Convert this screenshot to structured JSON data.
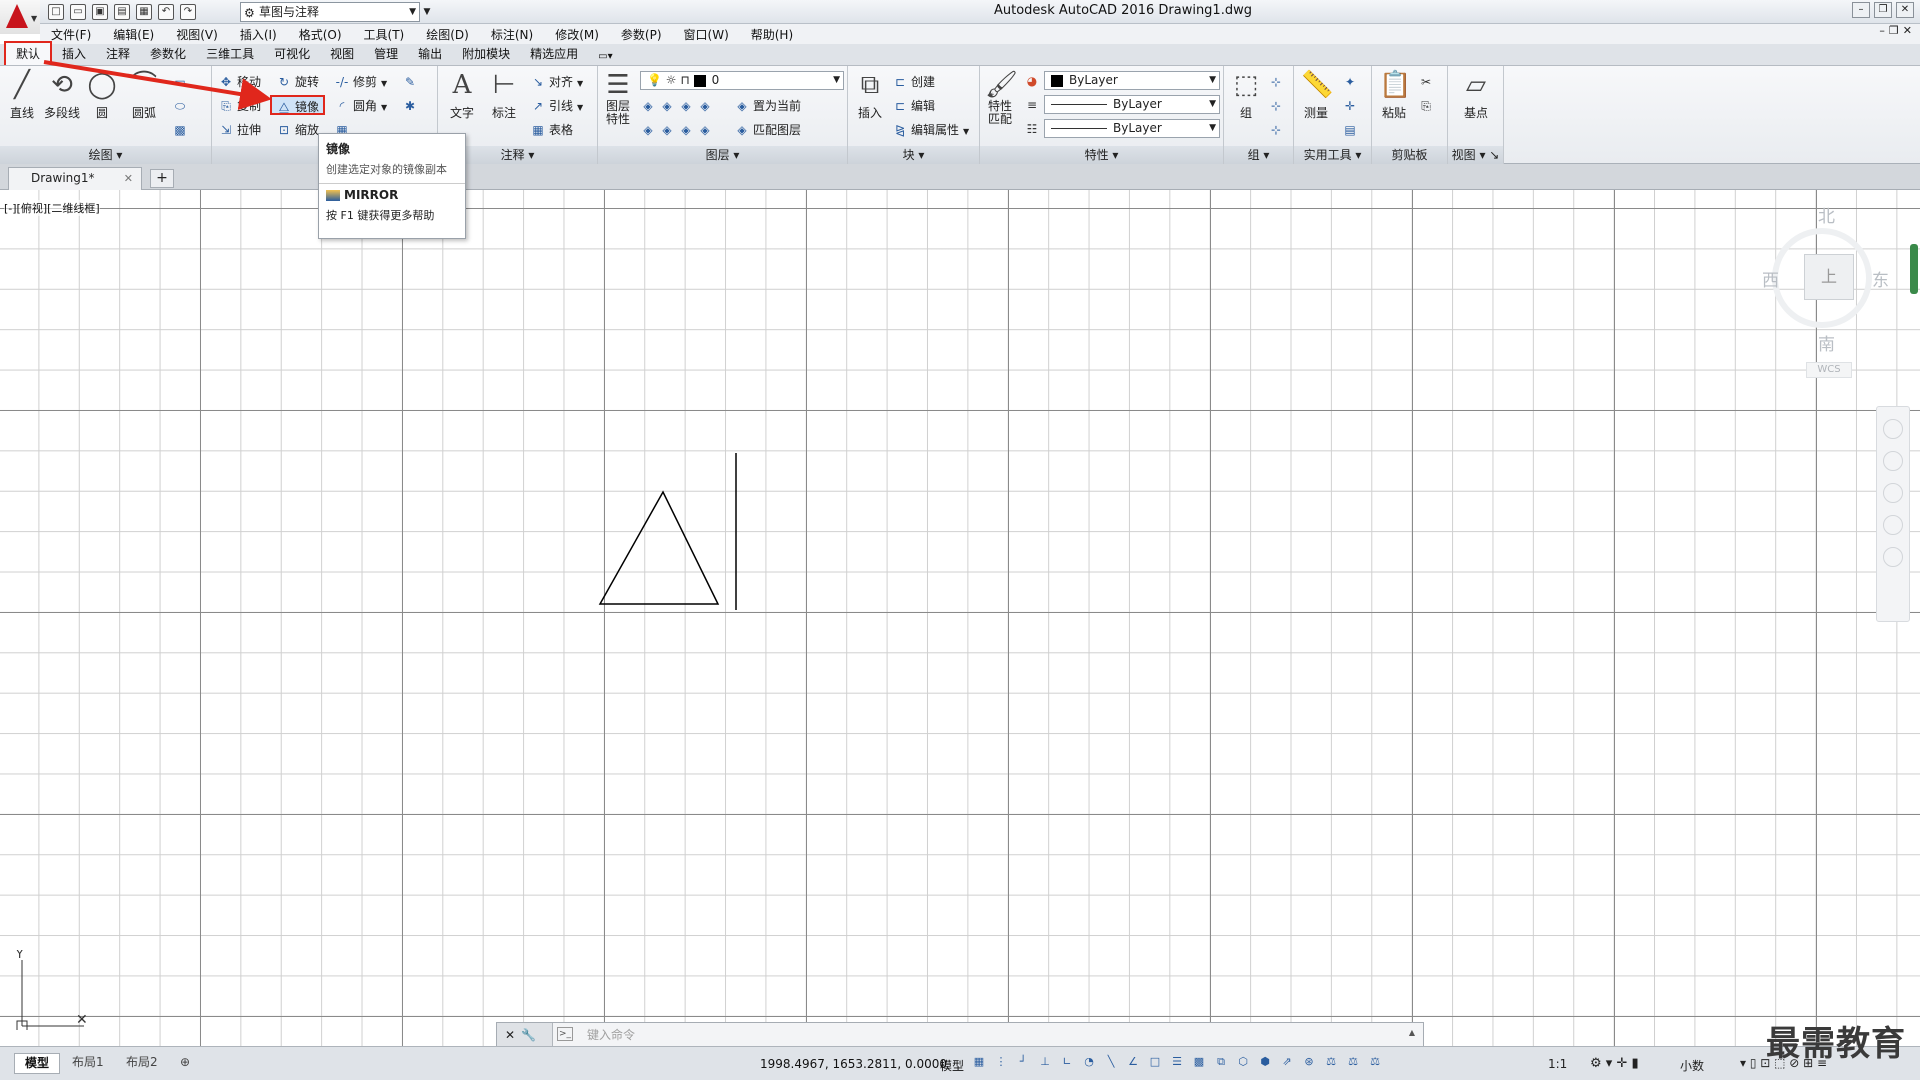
{
  "window": {
    "title": "Autodesk AutoCAD 2016    Drawing1.dwg",
    "workspace": "草图与注释"
  },
  "menubar": [
    "文件(F)",
    "编辑(E)",
    "视图(V)",
    "插入(I)",
    "格式(O)",
    "工具(T)",
    "绘图(D)",
    "标注(N)",
    "修改(M)",
    "参数(P)",
    "窗口(W)",
    "帮助(H)"
  ],
  "ribbon_tabs": [
    "默认",
    "插入",
    "注释",
    "参数化",
    "三维工具",
    "可视化",
    "视图",
    "管理",
    "输出",
    "附加模块",
    "精选应用"
  ],
  "ribbon": {
    "draw": {
      "title": "绘图",
      "line": "直线",
      "polyline": "多段线",
      "circle": "圆",
      "arc": "圆弧"
    },
    "modify": {
      "title": "修",
      "move": "移动",
      "rotate": "旋转",
      "trim": "修剪",
      "copy": "复制",
      "mirror": "镜像",
      "fillet": "圆角",
      "stretch": "拉伸",
      "scale": "缩放"
    },
    "annotation": {
      "title": "注释",
      "text": "文字",
      "dimension": "标注",
      "align": "对齐",
      "leader": "引线",
      "table": "表格"
    },
    "layers": {
      "title": "图层",
      "props": "图层\n特性",
      "layer_name": "0",
      "set_current": "置为当前",
      "match_layer": "匹配图层"
    },
    "block": {
      "title": "块",
      "insert": "插入",
      "create": "创建",
      "edit": "编辑",
      "edit_attr": "编辑属性"
    },
    "properties": {
      "title": "特性",
      "match": "特性\n匹配",
      "color": "ByLayer",
      "linetype": "ByLayer",
      "lineweight": "ByLayer"
    },
    "groups": {
      "title": "组",
      "group": "组"
    },
    "utilities": {
      "title": "实用工具",
      "measure": "测量"
    },
    "clipboard": {
      "title": "剪贴板",
      "paste": "粘贴"
    },
    "view": {
      "title": "视图",
      "base": "基点"
    }
  },
  "tooltip": {
    "title": "镜像",
    "description": "创建选定对象的镜像副本",
    "command": "MIRROR",
    "help": "按 F1 键获得更多帮助"
  },
  "file_tab": {
    "name": "Drawing1*"
  },
  "viewport_label": "[-][俯视][二维线框]",
  "viewcube": {
    "north": "北",
    "south": "南",
    "east": "东",
    "west": "西",
    "face": "上",
    "wcs": "WCS"
  },
  "command_line": {
    "placeholder": "键入命令"
  },
  "status": {
    "layout_tabs": [
      "模型",
      "布局1",
      "布局2"
    ],
    "coords": "1998.4967, 1653.2811, 0.0000",
    "model": "模型",
    "scale": "1:1",
    "units": "小数"
  },
  "watermark": "最需教育",
  "colors": {
    "accent_red": "#e0271c",
    "brand_red": "#c8141c",
    "icon_blue": "#2a5d9f"
  }
}
